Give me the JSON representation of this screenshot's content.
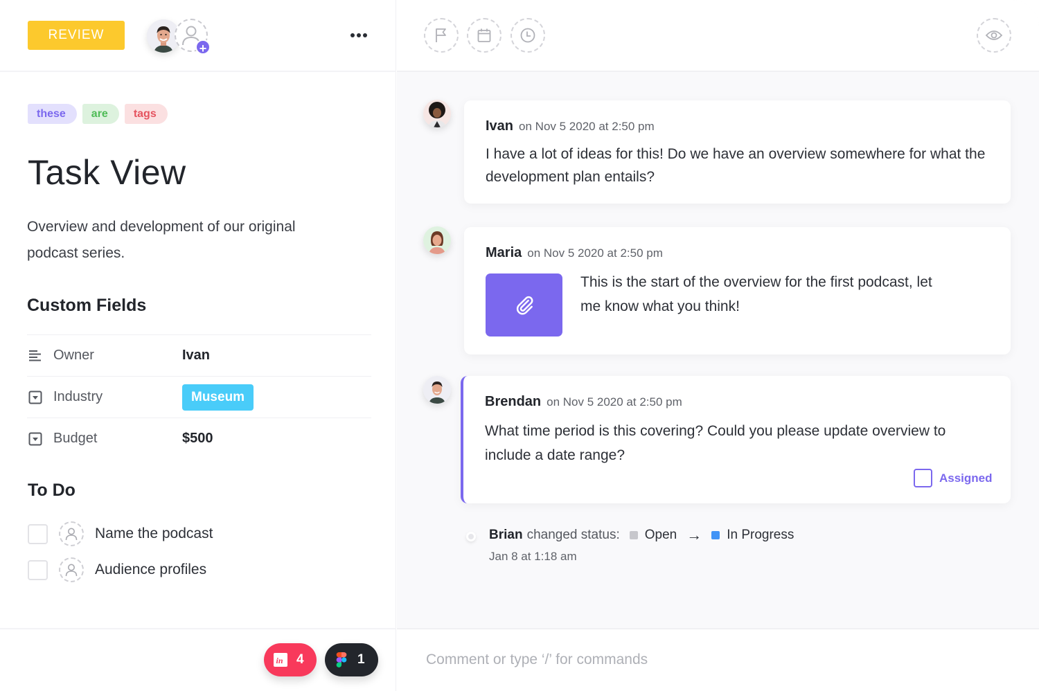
{
  "left_panel": {
    "status_button": "REVIEW",
    "colors": {
      "status": "#fcc92d",
      "accent": "#7b68ee"
    },
    "tags": [
      {
        "label": "these",
        "color": "purple"
      },
      {
        "label": "are",
        "color": "green"
      },
      {
        "label": "tags",
        "color": "red"
      }
    ],
    "title": "Task View",
    "description": "Overview and development of our original podcast series.",
    "custom_fields": {
      "heading": "Custom Fields",
      "rows": [
        {
          "icon": "text-lines-icon",
          "label": "Owner",
          "value": "Ivan"
        },
        {
          "icon": "dropdown-icon",
          "label": "Industry",
          "value": "Museum"
        },
        {
          "icon": "dropdown-icon",
          "label": "Budget",
          "value": "$500"
        }
      ]
    },
    "todo": {
      "heading": "To Do",
      "items": [
        {
          "text": "Name the podcast",
          "checked": false
        },
        {
          "text": "Audience profiles",
          "checked": false
        }
      ]
    },
    "integrations": [
      {
        "name": "invision",
        "count": "4"
      },
      {
        "name": "figma",
        "count": "1"
      }
    ]
  },
  "right_panel": {
    "header_icons": [
      "flag-icon",
      "calendar-icon",
      "clock-icon",
      "eye-icon"
    ],
    "comments": [
      {
        "author": "Ivan",
        "time": "on Nov 5 2020 at 2:50 pm",
        "text": "I have a lot of ideas for this! Do we have an overview somewhere for what the development plan entails?"
      },
      {
        "author": "Maria",
        "time": "on Nov 5 2020 at 2:50 pm",
        "text": "This is the start of the overview for the first podcast, let me know what you think!",
        "attachment": "paperclip-icon"
      },
      {
        "author": "Brendan",
        "time": "on Nov 5 2020 at 2:50 pm",
        "text": "What time period is this covering? Could you please update overview to include a date range?",
        "assigned_label": "Assigned"
      }
    ],
    "activity": {
      "who": "Brian",
      "action": "changed status:",
      "from": "Open",
      "from_color": "#c7c7cc",
      "arrow": "→",
      "to": "In Progress",
      "to_color": "#4194f6",
      "when": "Jan 8 at 1:18 am"
    },
    "comment_input": {
      "placeholder": "Comment or type ‘/’ for commands",
      "value": ""
    }
  }
}
